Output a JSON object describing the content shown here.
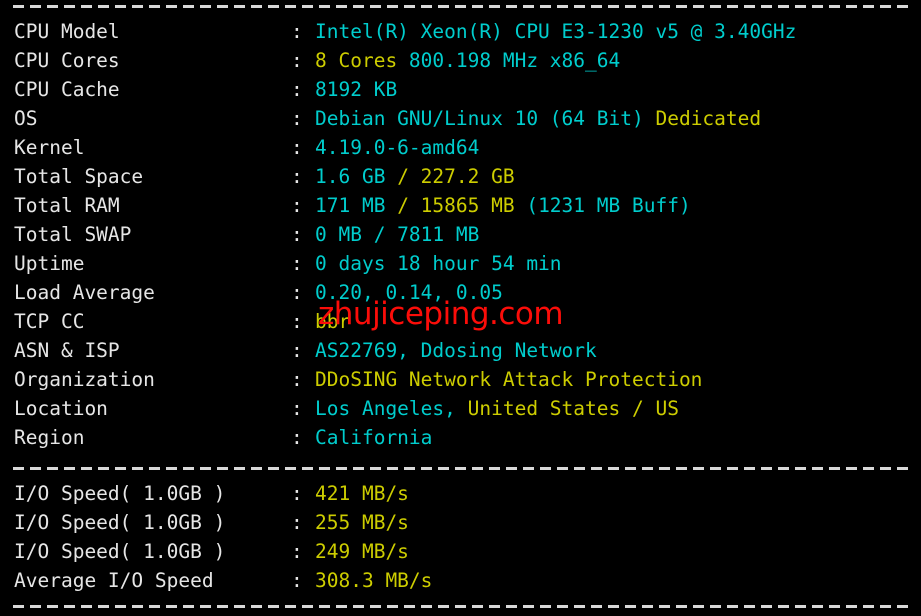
{
  "terminal": {
    "background": "#000000",
    "label_color": "#e6e6e6",
    "cyan": "#00cdcd",
    "yellow": "#cdcd00",
    "watermark_color": "#fb0d09"
  },
  "watermark": {
    "text": "zhujiceping.com"
  },
  "system": {
    "rows": [
      {
        "label": "CPU Model",
        "colon": ":",
        "segments": [
          {
            "text": "Intel(R) Xeon(R) CPU E3-1230 v5 @ 3.40GHz",
            "color": "cyan"
          }
        ]
      },
      {
        "label": "CPU Cores",
        "colon": ":",
        "segments": [
          {
            "text": "8 Cores ",
            "color": "yellow"
          },
          {
            "text": "800.198 MHz x86_64",
            "color": "cyan"
          }
        ]
      },
      {
        "label": "CPU Cache",
        "colon": ":",
        "segments": [
          {
            "text": "8192 KB",
            "color": "cyan"
          }
        ]
      },
      {
        "label": "OS",
        "colon": ":",
        "segments": [
          {
            "text": "Debian GNU/Linux 10 (64 Bit) ",
            "color": "cyan"
          },
          {
            "text": "Dedicated",
            "color": "yellow"
          }
        ]
      },
      {
        "label": "Kernel",
        "colon": ":",
        "segments": [
          {
            "text": "4.19.0-6-amd64",
            "color": "cyan"
          }
        ]
      },
      {
        "label": "Total Space",
        "colon": ":",
        "segments": [
          {
            "text": "1.6 GB ",
            "color": "cyan"
          },
          {
            "text": "/ 227.2 GB",
            "color": "yellow"
          }
        ]
      },
      {
        "label": "Total RAM",
        "colon": ":",
        "segments": [
          {
            "text": "171 MB ",
            "color": "cyan"
          },
          {
            "text": "/ 15865 MB ",
            "color": "yellow"
          },
          {
            "text": "(1231 MB Buff)",
            "color": "cyan"
          }
        ]
      },
      {
        "label": "Total SWAP",
        "colon": ":",
        "segments": [
          {
            "text": "0 MB / 7811 MB",
            "color": "cyan"
          }
        ]
      },
      {
        "label": "Uptime",
        "colon": ":",
        "segments": [
          {
            "text": "0 days 18 hour 54 min",
            "color": "cyan"
          }
        ]
      },
      {
        "label": "Load Average",
        "colon": ":",
        "segments": [
          {
            "text": "0.20, 0.14, 0.05",
            "color": "cyan"
          }
        ]
      },
      {
        "label": "TCP CC",
        "colon": ":",
        "segments": [
          {
            "text": "bbr",
            "color": "yellow"
          }
        ]
      },
      {
        "label": "ASN & ISP",
        "colon": ":",
        "segments": [
          {
            "text": "AS22769, Ddosing Network",
            "color": "cyan"
          }
        ]
      },
      {
        "label": "Organization",
        "colon": ":",
        "segments": [
          {
            "text": "DDoSING Network Attack Protection",
            "color": "yellow"
          }
        ]
      },
      {
        "label": "Location",
        "colon": ":",
        "segments": [
          {
            "text": "Los Angeles, ",
            "color": "cyan"
          },
          {
            "text": "United States / US",
            "color": "yellow"
          }
        ]
      },
      {
        "label": "Region",
        "colon": ":",
        "segments": [
          {
            "text": "California",
            "color": "cyan"
          }
        ]
      }
    ]
  },
  "io": {
    "rows": [
      {
        "label": "I/O Speed( 1.0GB )",
        "colon": ":",
        "segments": [
          {
            "text": "421 MB/s",
            "color": "yellow"
          }
        ]
      },
      {
        "label": "I/O Speed( 1.0GB )",
        "colon": ":",
        "segments": [
          {
            "text": "255 MB/s",
            "color": "yellow"
          }
        ]
      },
      {
        "label": "I/O Speed( 1.0GB )",
        "colon": ":",
        "segments": [
          {
            "text": "249 MB/s",
            "color": "yellow"
          }
        ]
      },
      {
        "label": "Average I/O Speed",
        "colon": ":",
        "segments": [
          {
            "text": "308.3 MB/s",
            "color": "yellow"
          }
        ]
      }
    ]
  }
}
